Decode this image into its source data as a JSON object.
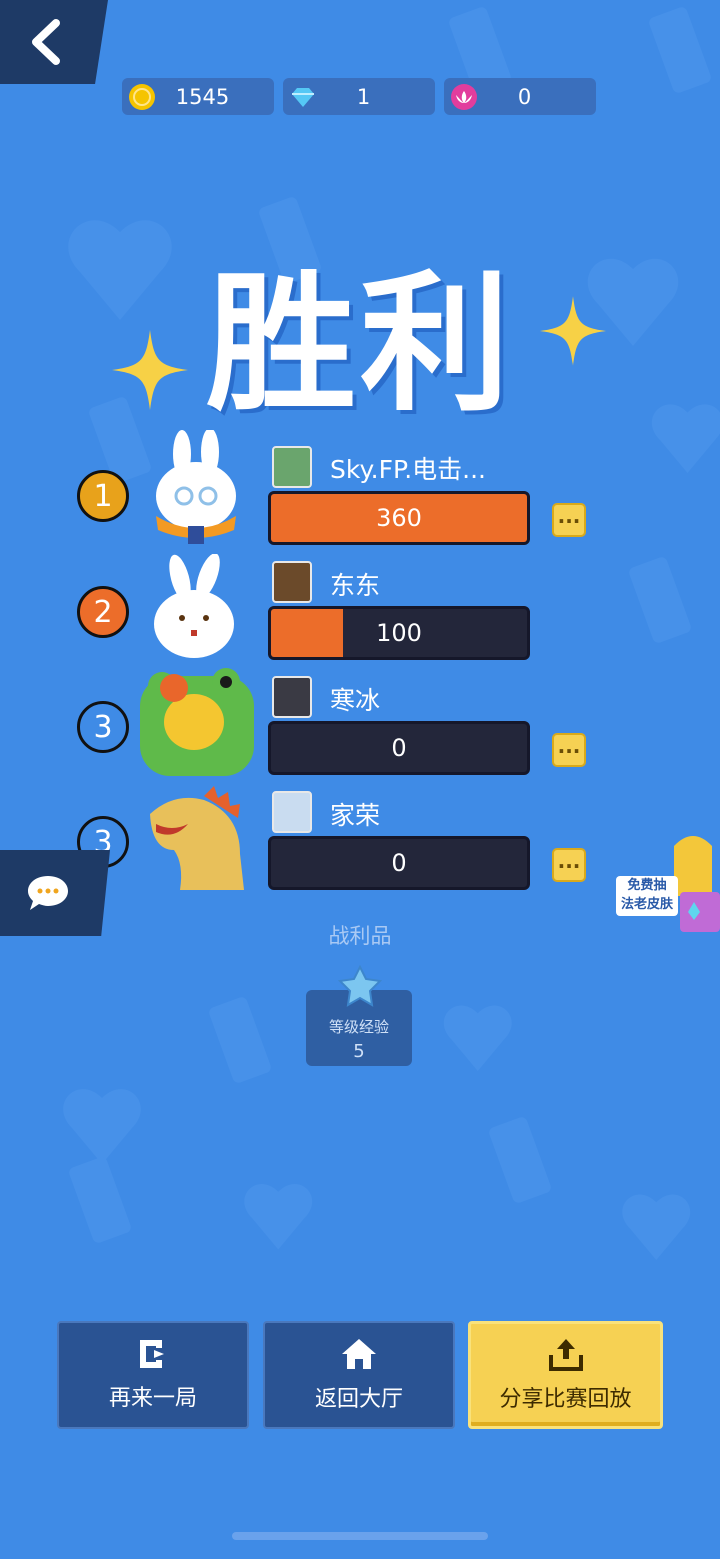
{
  "currency": [
    {
      "name": "coin-icon",
      "value": "1545",
      "color": "#f5c400"
    },
    {
      "name": "diamond-icon",
      "value": "1",
      "color": "#55c8f5"
    },
    {
      "name": "lotus-icon",
      "value": "0",
      "color": "#e23d9d"
    }
  ],
  "title": "胜利",
  "players": [
    {
      "rank": "1",
      "name": "Sky.FP.电击...",
      "score": "360",
      "progress": 1.0,
      "rank_color": "#e8a21b",
      "has_more": true
    },
    {
      "rank": "2",
      "name": "东东",
      "score": "100",
      "progress": 0.28,
      "rank_color": "#ec6d2a",
      "has_more": false
    },
    {
      "rank": "3",
      "name": "寒冰",
      "score": "0",
      "progress": 0,
      "rank_color": "#3f8be6",
      "has_more": true
    },
    {
      "rank": "3",
      "name": "家荣",
      "score": "0",
      "progress": 0,
      "rank_color": "#3f8be6",
      "has_more": true
    }
  ],
  "loot": {
    "title": "战利品",
    "item_label": "等级经验",
    "item_value": "5"
  },
  "promo": {
    "line1": "免费抽",
    "line2": "法老皮肤"
  },
  "buttons": {
    "again": "再来一局",
    "lobby": "返回大厅",
    "share": "分享比赛回放"
  }
}
